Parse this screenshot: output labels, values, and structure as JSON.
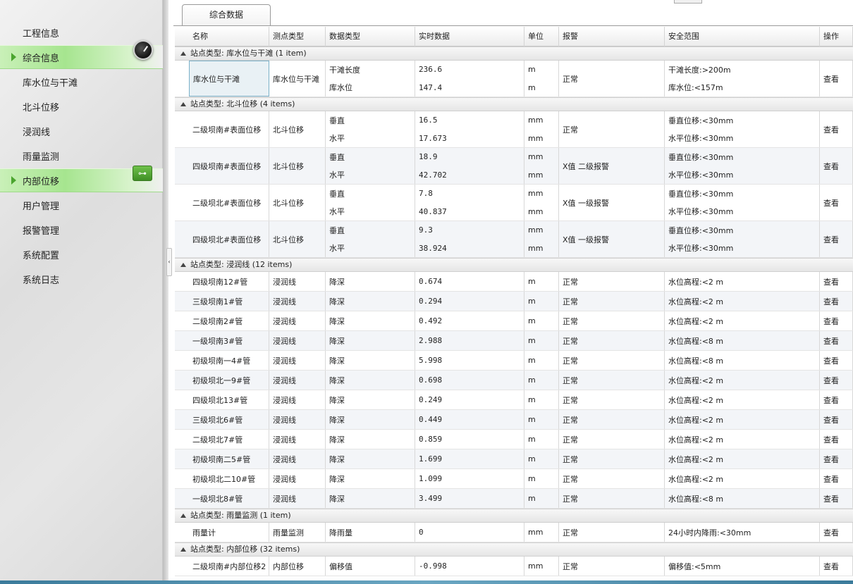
{
  "sidebar": {
    "items": [
      {
        "label": "工程信息",
        "active": false
      },
      {
        "label": "综合信息",
        "active": true
      },
      {
        "label": "库水位与干滩",
        "active": false
      },
      {
        "label": "北斗位移",
        "active": false
      },
      {
        "label": "浸润线",
        "active": false
      },
      {
        "label": "雨量监测",
        "active": false
      },
      {
        "label": "内部位移",
        "active": true
      },
      {
        "label": "用户管理",
        "active": false
      },
      {
        "label": "报警管理",
        "active": false
      },
      {
        "label": "系统配置",
        "active": false
      },
      {
        "label": "系统日志",
        "active": false
      }
    ],
    "badges": {
      "gauge": "gauge-icon",
      "link": "link-icon",
      "link_glyph": "⊶"
    },
    "accent_color": "#a6e58f"
  },
  "tab": {
    "label": "综合数据"
  },
  "collapse_glyph": "‹",
  "columns": [
    "名称",
    "测点类型",
    "数据类型",
    "实时数据",
    "单位",
    "报警",
    "安全范围",
    "操作"
  ],
  "groups": [
    {
      "label": "站点类型: 库水位与干滩 (1 item)",
      "rows": [
        {
          "name": "库水位与干滩",
          "type": "库水位与干滩",
          "dtype": [
            "干滩长度",
            "库水位"
          ],
          "value": [
            "236.6",
            "147.4"
          ],
          "unit": [
            "m",
            "m"
          ],
          "alarm": "正常",
          "range": [
            "干滩长度:>200m",
            "库水位:<157m"
          ],
          "action": "查看"
        }
      ]
    },
    {
      "label": "站点类型: 北斗位移 (4 items)",
      "rows": [
        {
          "name": "二级坝南#表面位移",
          "type": "北斗位移",
          "dtype": [
            "垂直",
            "水平"
          ],
          "value": [
            "16.5",
            "17.673"
          ],
          "unit": [
            "mm",
            "mm"
          ],
          "alarm": "正常",
          "range": [
            "垂直位移:<30mm",
            "水平位移:<30mm"
          ],
          "action": "查看"
        },
        {
          "name": "四级坝南#表面位移",
          "type": "北斗位移",
          "dtype": [
            "垂直",
            "水平"
          ],
          "value": [
            "18.9",
            "42.702"
          ],
          "unit": [
            "mm",
            "mm"
          ],
          "alarm": "X值 二级报警",
          "range": [
            "垂直位移:<30mm",
            "水平位移:<30mm"
          ],
          "action": "查看"
        },
        {
          "name": "二级坝北#表面位移",
          "type": "北斗位移",
          "dtype": [
            "垂直",
            "水平"
          ],
          "value": [
            "7.8",
            "40.837"
          ],
          "unit": [
            "mm",
            "mm"
          ],
          "alarm": "X值 一级报警",
          "range": [
            "垂直位移:<30mm",
            "水平位移:<30mm"
          ],
          "action": "查看"
        },
        {
          "name": "四级坝北#表面位移",
          "type": "北斗位移",
          "dtype": [
            "垂直",
            "水平"
          ],
          "value": [
            "9.3",
            "38.924"
          ],
          "unit": [
            "mm",
            "mm"
          ],
          "alarm": "X值 一级报警",
          "range": [
            "垂直位移:<30mm",
            "水平位移:<30mm"
          ],
          "action": "查看"
        }
      ]
    },
    {
      "label": "站点类型: 浸润线 (12 items)",
      "rows": [
        {
          "name": "四级坝南12#管",
          "type": "浸润线",
          "dtype": [
            "降深"
          ],
          "value": [
            "0.674"
          ],
          "unit": [
            "m"
          ],
          "alarm": "正常",
          "range": [
            "水位高程:<2 m"
          ],
          "action": "查看"
        },
        {
          "name": "三级坝南1#管",
          "type": "浸润线",
          "dtype": [
            "降深"
          ],
          "value": [
            "0.294"
          ],
          "unit": [
            "m"
          ],
          "alarm": "正常",
          "range": [
            "水位高程:<2 m"
          ],
          "action": "查看"
        },
        {
          "name": "二级坝南2#管",
          "type": "浸润线",
          "dtype": [
            "降深"
          ],
          "value": [
            "0.492"
          ],
          "unit": [
            "m"
          ],
          "alarm": "正常",
          "range": [
            "水位高程:<2 m"
          ],
          "action": "查看"
        },
        {
          "name": "一级坝南3#管",
          "type": "浸润线",
          "dtype": [
            "降深"
          ],
          "value": [
            "2.988"
          ],
          "unit": [
            "m"
          ],
          "alarm": "正常",
          "range": [
            "水位高程:<8 m"
          ],
          "action": "查看"
        },
        {
          "name": "初级坝南一4#管",
          "type": "浸润线",
          "dtype": [
            "降深"
          ],
          "value": [
            "5.998"
          ],
          "unit": [
            "m"
          ],
          "alarm": "正常",
          "range": [
            "水位高程:<8 m"
          ],
          "action": "查看"
        },
        {
          "name": "初级坝北一9#管",
          "type": "浸润线",
          "dtype": [
            "降深"
          ],
          "value": [
            "0.698"
          ],
          "unit": [
            "m"
          ],
          "alarm": "正常",
          "range": [
            "水位高程:<2 m"
          ],
          "action": "查看"
        },
        {
          "name": "四级坝北13#管",
          "type": "浸润线",
          "dtype": [
            "降深"
          ],
          "value": [
            "0.249"
          ],
          "unit": [
            "m"
          ],
          "alarm": "正常",
          "range": [
            "水位高程:<2 m"
          ],
          "action": "查看"
        },
        {
          "name": "三级坝北6#管",
          "type": "浸润线",
          "dtype": [
            "降深"
          ],
          "value": [
            "0.449"
          ],
          "unit": [
            "m"
          ],
          "alarm": "正常",
          "range": [
            "水位高程:<2 m"
          ],
          "action": "查看"
        },
        {
          "name": "二级坝北7#管",
          "type": "浸润线",
          "dtype": [
            "降深"
          ],
          "value": [
            "0.859"
          ],
          "unit": [
            "m"
          ],
          "alarm": "正常",
          "range": [
            "水位高程:<2 m"
          ],
          "action": "查看"
        },
        {
          "name": "初级坝南二5#管",
          "type": "浸润线",
          "dtype": [
            "降深"
          ],
          "value": [
            "1.699"
          ],
          "unit": [
            "m"
          ],
          "alarm": "正常",
          "range": [
            "水位高程:<2 m"
          ],
          "action": "查看"
        },
        {
          "name": "初级坝北二10#管",
          "type": "浸润线",
          "dtype": [
            "降深"
          ],
          "value": [
            "1.099"
          ],
          "unit": [
            "m"
          ],
          "alarm": "正常",
          "range": [
            "水位高程:<2 m"
          ],
          "action": "查看"
        },
        {
          "name": "一级坝北8#管",
          "type": "浸润线",
          "dtype": [
            "降深"
          ],
          "value": [
            "3.499"
          ],
          "unit": [
            "m"
          ],
          "alarm": "正常",
          "range": [
            "水位高程:<8 m"
          ],
          "action": "查看"
        }
      ]
    },
    {
      "label": "站点类型: 雨量监测 (1 item)",
      "rows": [
        {
          "name": "雨量计",
          "type": "雨量监测",
          "dtype": [
            "降雨量"
          ],
          "value": [
            "0"
          ],
          "unit": [
            "mm"
          ],
          "alarm": "正常",
          "range": [
            "24小时内降雨:<30mm"
          ],
          "action": "查看"
        }
      ]
    },
    {
      "label": "站点类型: 内部位移 (32 items)",
      "rows": [
        {
          "name": "二级坝南#内部位移2",
          "type": "内部位移",
          "dtype": [
            "偏移值"
          ],
          "value": [
            "-0.998"
          ],
          "unit": [
            "mm"
          ],
          "alarm": "正常",
          "range": [
            "偏移值:<5mm"
          ],
          "action": "查看"
        }
      ]
    }
  ]
}
